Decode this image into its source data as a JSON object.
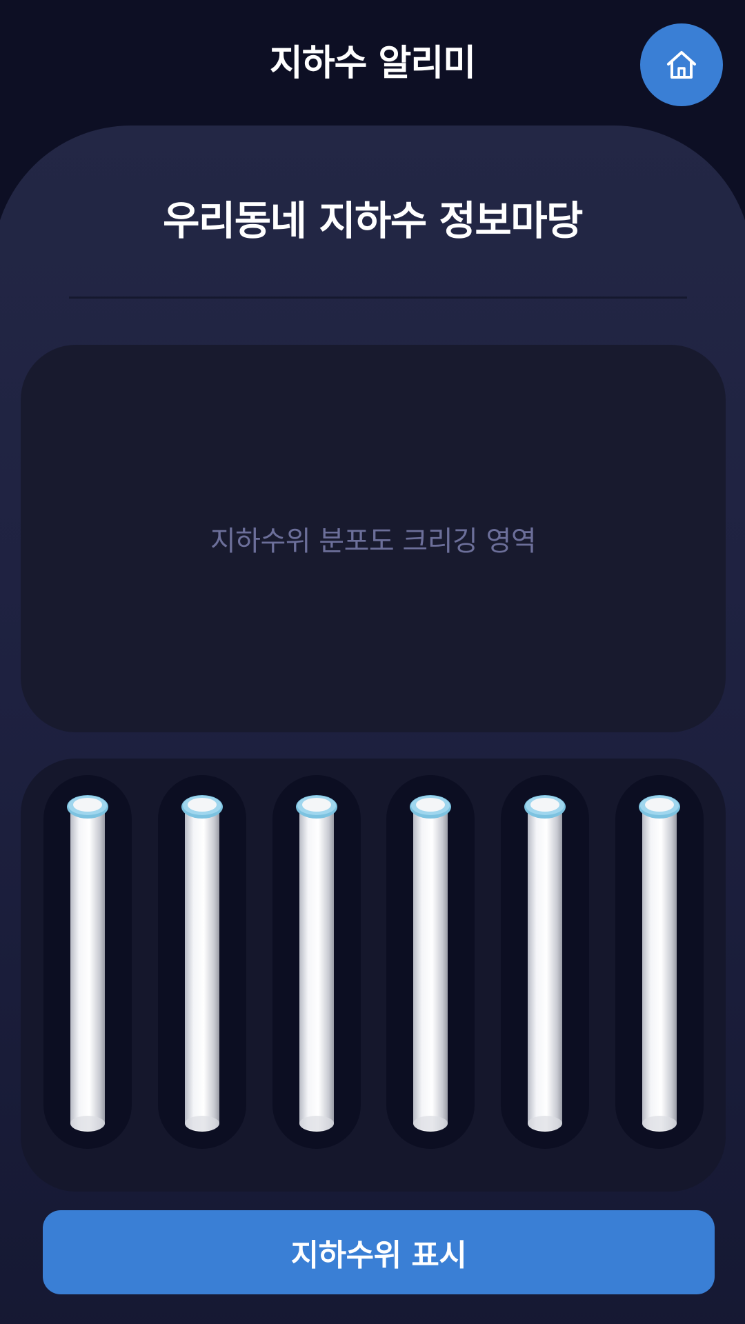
{
  "header": {
    "app_title": "지하수 알리미",
    "home_icon": "home-icon"
  },
  "main": {
    "section_title": "우리동네 지하수 정보마당",
    "map_placeholder": "지하수위 분포도 크리깅 영역"
  },
  "wells": {
    "count": 6,
    "items": [
      {
        "id": "well-1"
      },
      {
        "id": "well-2"
      },
      {
        "id": "well-3"
      },
      {
        "id": "well-4"
      },
      {
        "id": "well-5"
      },
      {
        "id": "well-6"
      }
    ]
  },
  "footer": {
    "show_level_label": "지하수위 표시"
  },
  "colors": {
    "background": "#0d0f24",
    "panel": "#232745",
    "accent": "#3a7fd5",
    "pipe_rim": "#7cc2e0",
    "placeholder_text": "#6c6f9a"
  }
}
